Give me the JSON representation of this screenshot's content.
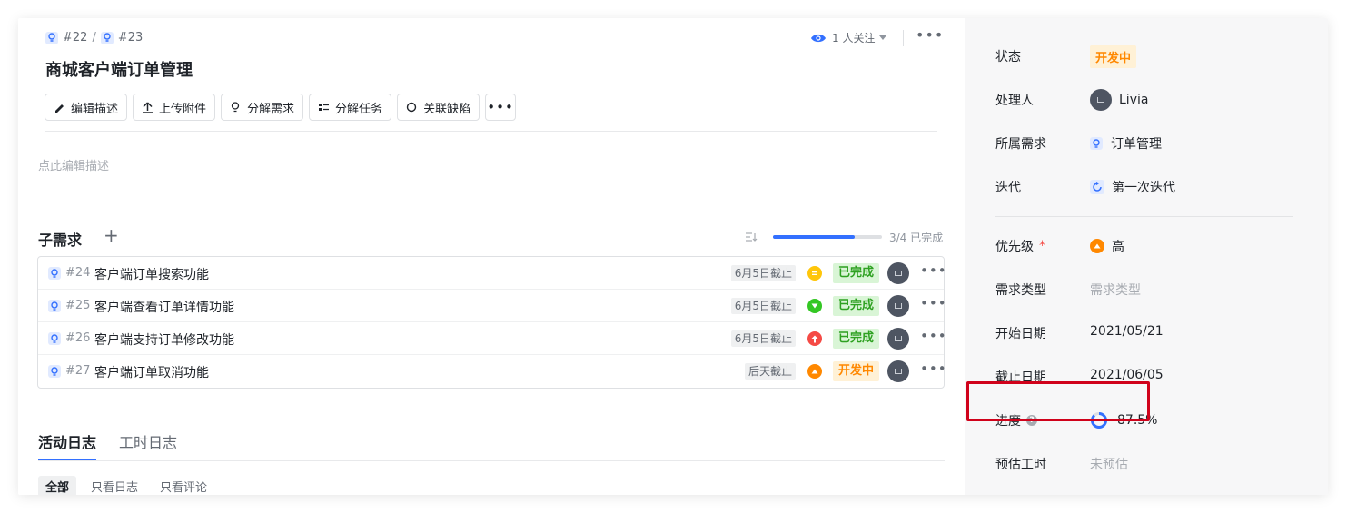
{
  "breadcrumb": {
    "parent_num": "#22",
    "separator": "/",
    "current_num": "#23"
  },
  "header": {
    "title": "商城客户端订单管理",
    "watchers": "1 人关注"
  },
  "toolbar": {
    "edit_desc": "编辑描述",
    "upload": "上传附件",
    "split_req": "分解需求",
    "split_task": "分解任务",
    "link_bug": "关联缺陷"
  },
  "description": {
    "placeholder": "点此编辑描述"
  },
  "sub_requirements": {
    "title": "子需求",
    "add": "+",
    "progress_text": "3/4 已完成",
    "progress_fraction": 0.75,
    "rows": [
      {
        "num": "#24",
        "title": "客户端订单搜索功能",
        "due": "6月5日截止",
        "priority": "medium",
        "priority_color": "#ffc60a",
        "status": "已完成",
        "status_kind": "done"
      },
      {
        "num": "#25",
        "title": "客户端查看订单详情功能",
        "due": "6月5日截止",
        "priority": "low",
        "priority_color": "#34c724",
        "status": "已完成",
        "status_kind": "done"
      },
      {
        "num": "#26",
        "title": "客户端支持订单修改功能",
        "due": "6月5日截止",
        "priority": "urgent",
        "priority_color": "#f54a45",
        "status": "已完成",
        "status_kind": "done"
      },
      {
        "num": "#27",
        "title": "客户端订单取消功能",
        "due": "后天截止",
        "priority": "high",
        "priority_color": "#ff8800",
        "status": "开发中",
        "status_kind": "dev"
      }
    ]
  },
  "tabs": {
    "activity": "活动日志",
    "worklog": "工时日志"
  },
  "filters": {
    "all": "全部",
    "logs_only": "只看日志",
    "comments_only": "只看评论"
  },
  "side": {
    "status_label": "状态",
    "status_value": "开发中",
    "assignee_label": "处理人",
    "assignee_value": "Livia",
    "parent_label": "所属需求",
    "parent_value": "订单管理",
    "iteration_label": "迭代",
    "iteration_value": "第一次迭代",
    "priority_label": "优先级",
    "priority_required": "*",
    "priority_value": "高",
    "type_label": "需求类型",
    "type_placeholder": "需求类型",
    "start_label": "开始日期",
    "start_value": "2021/05/21",
    "end_label": "截止日期",
    "end_value": "2021/06/05",
    "progress_label": "进度",
    "progress_value": "87.5%",
    "progress_fraction": 0.875,
    "estimate_label": "预估工时",
    "estimate_value": "未预估"
  },
  "colors": {
    "accent": "#3370ff",
    "done": "#2ea121",
    "dev": "#ff8800",
    "highlight": "#d0021b"
  }
}
